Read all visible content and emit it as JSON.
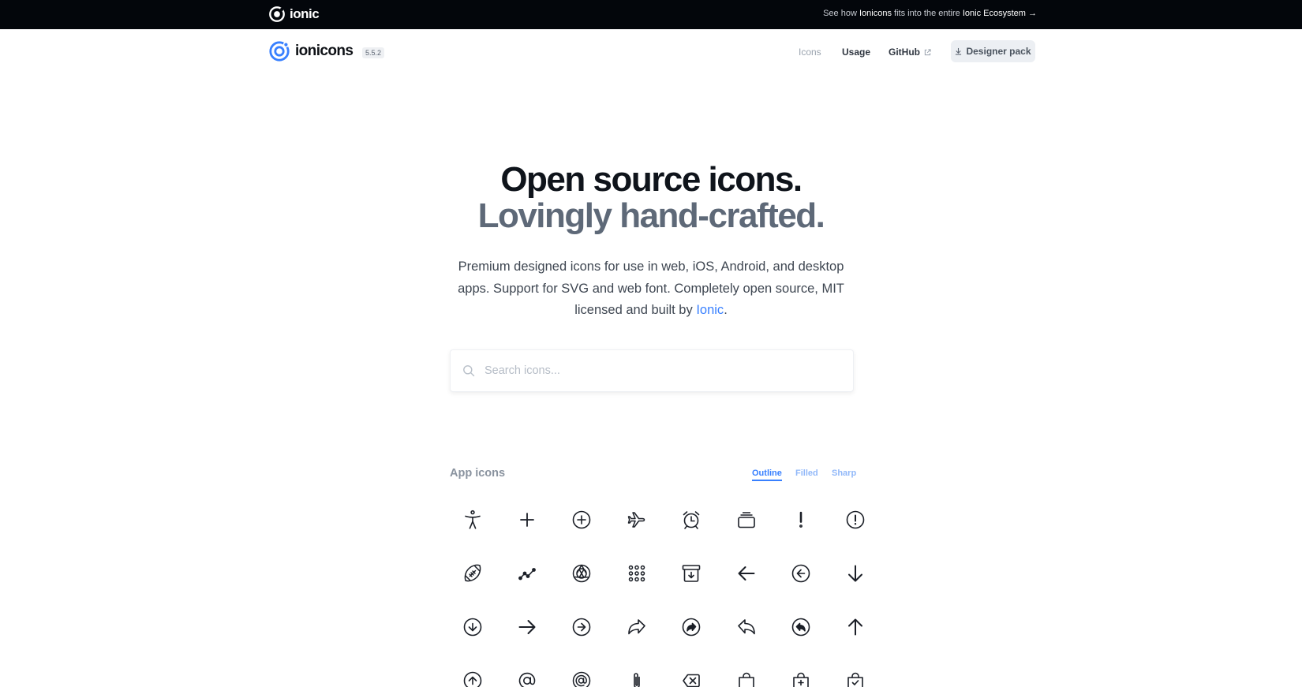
{
  "topbar": {
    "brand": "ionic",
    "ecosystem_pre": "See how ",
    "ecosystem_b1": "Ionicons",
    "ecosystem_mid": " fits into the entire ",
    "ecosystem_b2": "Ionic Ecosystem",
    "ecosystem_arrow": " →"
  },
  "header": {
    "logo_text": "ionicons",
    "version": "5.5.2",
    "nav": {
      "icons": "Icons",
      "usage": "Usage",
      "github": "GitHub"
    },
    "designer_pack": "Designer pack"
  },
  "hero": {
    "title_line1": "Open source icons.",
    "title_line2": "Lovingly hand-crafted.",
    "description_pre": "Premium designed icons for use in web, iOS, Android, and desktop apps. Support for SVG and web font. Completely open source, MIT licensed and built by ",
    "description_link": "Ionic",
    "description_post": "."
  },
  "search": {
    "placeholder": "Search icons..."
  },
  "section": {
    "title": "App icons",
    "tabs": {
      "outline": "Outline",
      "filled": "Filled",
      "sharp": "Sharp"
    },
    "active_tab": "Outline"
  },
  "icons": [
    "accessibility-icon",
    "add-icon",
    "add-circle-icon",
    "airplane-icon",
    "alarm-icon",
    "albums-icon",
    "alert-icon",
    "alert-circle-icon",
    "american-football-icon",
    "analytics-icon",
    "aperture-icon",
    "apps-icon",
    "archive-icon",
    "arrow-back-icon",
    "arrow-back-circle-icon",
    "arrow-down-icon",
    "arrow-down-circle-icon",
    "arrow-forward-icon",
    "arrow-forward-circle-icon",
    "arrow-redo-icon",
    "arrow-redo-circle-icon",
    "arrow-undo-icon",
    "arrow-undo-circle-icon",
    "arrow-up-icon",
    "arrow-up-circle-icon",
    "at-icon",
    "at-circle-icon",
    "attach-icon",
    "backspace-icon",
    "bag-icon",
    "bag-add-icon",
    "bag-check-icon"
  ],
  "colors": {
    "accent": "#3880ff",
    "topbar_bg": "#03060b",
    "title_dark": "#0f141b",
    "title_muted": "#5e6978"
  }
}
